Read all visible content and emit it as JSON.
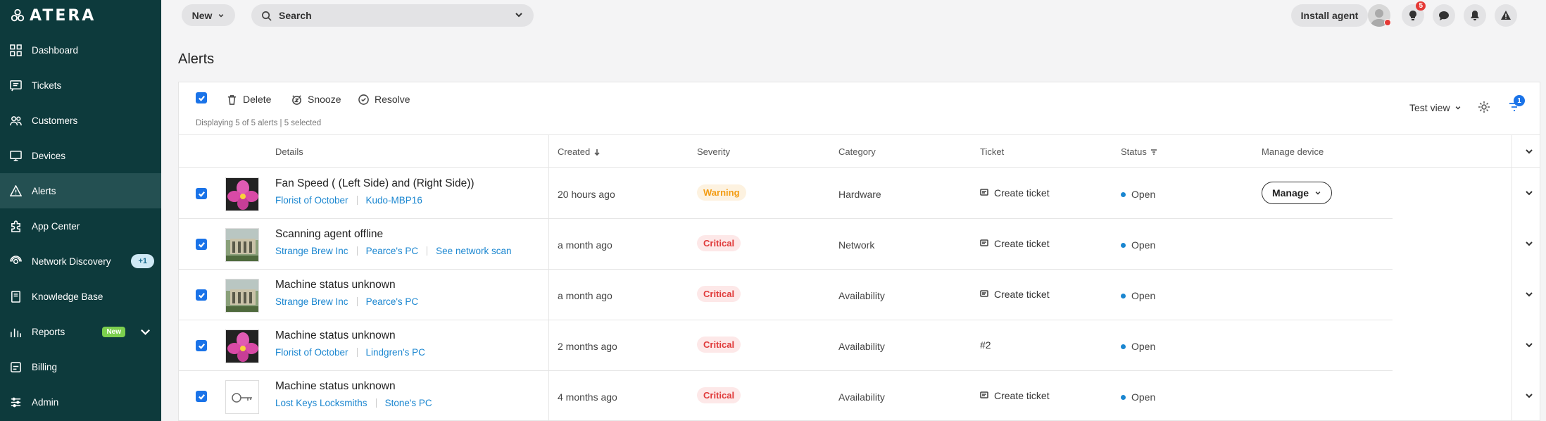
{
  "brand": {
    "name": "ATERA"
  },
  "sidebar": {
    "items": [
      {
        "label": "Dashboard",
        "icon": "dashboard-icon"
      },
      {
        "label": "Tickets",
        "icon": "ticket-icon"
      },
      {
        "label": "Customers",
        "icon": "customers-icon"
      },
      {
        "label": "Devices",
        "icon": "devices-icon"
      },
      {
        "label": "Alerts",
        "icon": "alert-icon",
        "active": true
      },
      {
        "label": "App Center",
        "icon": "app-center-icon"
      },
      {
        "label": "Network Discovery",
        "icon": "network-icon",
        "badge": "+1"
      },
      {
        "label": "Knowledge Base",
        "icon": "book-icon"
      },
      {
        "label": "Reports",
        "icon": "reports-icon",
        "badge": "New"
      },
      {
        "label": "Billing",
        "icon": "billing-icon"
      },
      {
        "label": "Admin",
        "icon": "admin-icon"
      }
    ]
  },
  "topbar": {
    "new_label": "New",
    "search_label": "Search",
    "install_label": "Install agent",
    "notifications_count": "5"
  },
  "page": {
    "title": "Alerts"
  },
  "toolbar": {
    "delete_label": "Delete",
    "snooze_label": "Snooze",
    "resolve_label": "Resolve",
    "displaying": "Displaying 5 of 5 alerts | 5 selected",
    "view_label": "Test view",
    "filter_count": "1"
  },
  "table": {
    "headers": {
      "details": "Details",
      "created": "Created",
      "severity": "Severity",
      "category": "Category",
      "ticket": "Ticket",
      "status": "Status",
      "manage": "Manage device"
    },
    "rows": [
      {
        "title": "Fan Speed ( (Left Side) and (Right Side))",
        "links": [
          "Florist of October",
          "Kudo-MBP16"
        ],
        "created": "20 hours ago",
        "severity": "Warning",
        "category": "Hardware",
        "ticket": "Create ticket",
        "status": "Open",
        "manage": "Manage",
        "thumb": "orchid"
      },
      {
        "title": "Scanning agent offline",
        "links": [
          "Strange Brew Inc",
          "Pearce's PC",
          "See network scan"
        ],
        "created": "a month ago",
        "severity": "Critical",
        "category": "Network",
        "ticket": "Create ticket",
        "status": "Open",
        "thumb": "building"
      },
      {
        "title": "Machine status unknown",
        "links": [
          "Strange Brew Inc",
          "Pearce's PC"
        ],
        "created": "a month ago",
        "severity": "Critical",
        "category": "Availability",
        "ticket": "Create ticket",
        "status": "Open",
        "thumb": "building"
      },
      {
        "title": "Machine status unknown",
        "links": [
          "Florist of October",
          "Lindgren's PC"
        ],
        "created": "2 months ago",
        "severity": "Critical",
        "category": "Availability",
        "ticket": "#2",
        "status": "Open",
        "thumb": "orchid"
      },
      {
        "title": "Machine status unknown",
        "links": [
          "Lost Keys Locksmiths",
          "Stone's PC"
        ],
        "created": "4 months ago",
        "severity": "Critical",
        "category": "Availability",
        "ticket": "Create ticket",
        "status": "Open",
        "thumb": "key"
      }
    ]
  },
  "colors": {
    "sidebar": "#0d3a3c",
    "accent": "#1a73e8",
    "link": "#1a86d0",
    "warning": "#f39c12",
    "critical": "#e03b3b"
  }
}
